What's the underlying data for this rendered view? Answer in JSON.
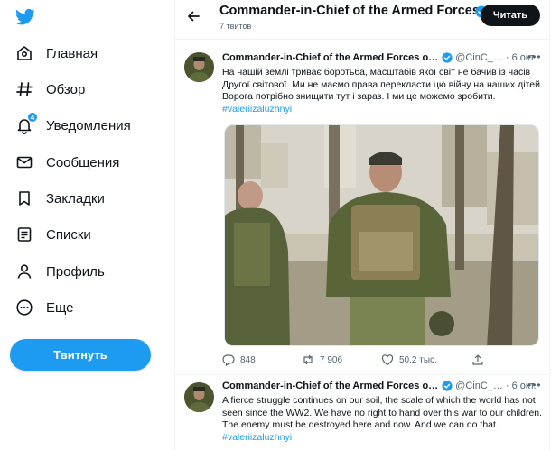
{
  "sidebar": {
    "logo_icon": "twitter-bird-icon",
    "items": [
      {
        "label": "Главная",
        "icon": "home-icon"
      },
      {
        "label": "Обзор",
        "icon": "hashtag-icon"
      },
      {
        "label": "Уведомления",
        "icon": "bell-icon",
        "badge": "4"
      },
      {
        "label": "Сообщения",
        "icon": "envelope-icon"
      },
      {
        "label": "Закладки",
        "icon": "bookmark-icon"
      },
      {
        "label": "Списки",
        "icon": "list-icon"
      },
      {
        "label": "Профиль",
        "icon": "person-icon"
      },
      {
        "label": "Еще",
        "icon": "more-circle-icon"
      }
    ],
    "tweet_button": "Твитнуть"
  },
  "header": {
    "title": "Commander-in-Chief of the Armed Forces…",
    "subtitle": "7 твитов",
    "follow_label": "Читать"
  },
  "tweets": [
    {
      "name": "Commander-in-Chief of the Armed Forces o…",
      "handle": "@CinC_…",
      "dot": "·",
      "date": "6 окт.",
      "lines": [
        "На нашій землі триває боротьба, масштабів якої світ не бачив із часів",
        "Другої світової. Ми не маємо права перекласти цю війну на наших дітей.",
        "Ворога потрібно знищити тут і зараз. І ми це можемо зробити."
      ],
      "hashtag": "#valeriizaluzhnyi",
      "replies": "848",
      "retweets": "7 906",
      "likes": "50,2 тыс."
    },
    {
      "name": "Commander-in-Chief of the Armed Forces o…",
      "handle": "@CinC_…",
      "dot": "·",
      "date": "6 окт.",
      "lines": [
        "A fierce struggle continues on our soil, the scale of which the world has not",
        "seen since the WW2. We have no right to hand over this war to our children.",
        "The enemy must be destroyed here and now. And we can do that."
      ],
      "hashtag": "#valeriizaluzhnyi"
    }
  ],
  "colors": {
    "accent": "#1d9bf0",
    "text": "#0f1419",
    "muted": "#536471",
    "button_dark": "#0f1419"
  }
}
